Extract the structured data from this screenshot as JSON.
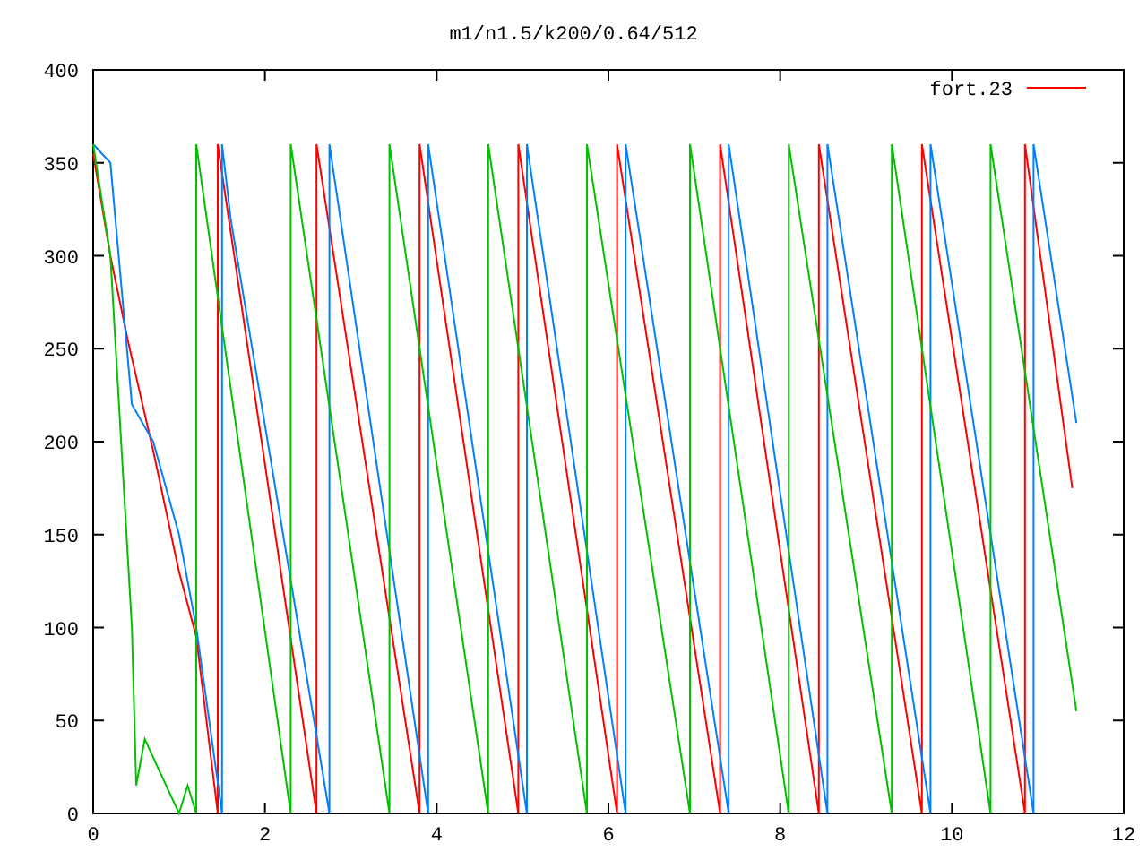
{
  "chart_data": {
    "type": "line",
    "title": "m1/n1.5/k200/0.64/512",
    "xlim": [
      0,
      12
    ],
    "ylim": [
      0,
      400
    ],
    "xticks": [
      0,
      2,
      4,
      6,
      8,
      10,
      12
    ],
    "yticks": [
      0,
      50,
      100,
      150,
      200,
      250,
      300,
      350,
      400
    ],
    "series": [
      {
        "name": "fort.23",
        "color": "#ff0000",
        "x": [
          0,
          0.2,
          0.4,
          0.7,
          1.0,
          1.2,
          1.45,
          1.45,
          2.6,
          2.6,
          3.8,
          3.8,
          4.95,
          4.95,
          6.1,
          6.1,
          7.3,
          7.3,
          8.45,
          8.45,
          9.65,
          9.65,
          10.85,
          10.85,
          11.4
        ],
        "values": [
          355,
          300,
          255,
          195,
          130,
          95,
          0,
          360,
          0,
          360,
          0,
          360,
          0,
          360,
          0,
          360,
          0,
          360,
          0,
          360,
          0,
          360,
          0,
          360,
          175
        ]
      },
      {
        "color": "#0080ff",
        "x": [
          0,
          0.2,
          0.45,
          0.7,
          1.0,
          1.2,
          1.35,
          1.5,
          1.5,
          1.6,
          2.75,
          2.75,
          3.9,
          3.9,
          5.05,
          5.05,
          6.2,
          6.2,
          7.4,
          7.4,
          8.55,
          8.55,
          9.75,
          9.75,
          10.95,
          10.95,
          11.45
        ],
        "values": [
          360,
          350,
          220,
          200,
          150,
          100,
          50,
          0,
          360,
          320,
          0,
          360,
          0,
          360,
          0,
          360,
          0,
          360,
          0,
          360,
          0,
          360,
          0,
          360,
          0,
          360,
          210
        ]
      },
      {
        "color": "#00c000",
        "x": [
          0,
          0.2,
          0.45,
          0.5,
          0.6,
          0.75,
          1.0,
          1.1,
          1.2,
          1.2,
          2.3,
          2.3,
          3.45,
          3.45,
          4.6,
          4.6,
          5.75,
          5.75,
          6.95,
          6.95,
          8.1,
          8.1,
          9.3,
          9.3,
          10.45,
          10.45,
          11.45
        ],
        "values": [
          360,
          300,
          100,
          15,
          40,
          25,
          0,
          15,
          0,
          360,
          0,
          360,
          0,
          360,
          0,
          360,
          0,
          360,
          0,
          360,
          0,
          360,
          0,
          360,
          0,
          360,
          55
        ]
      }
    ]
  }
}
